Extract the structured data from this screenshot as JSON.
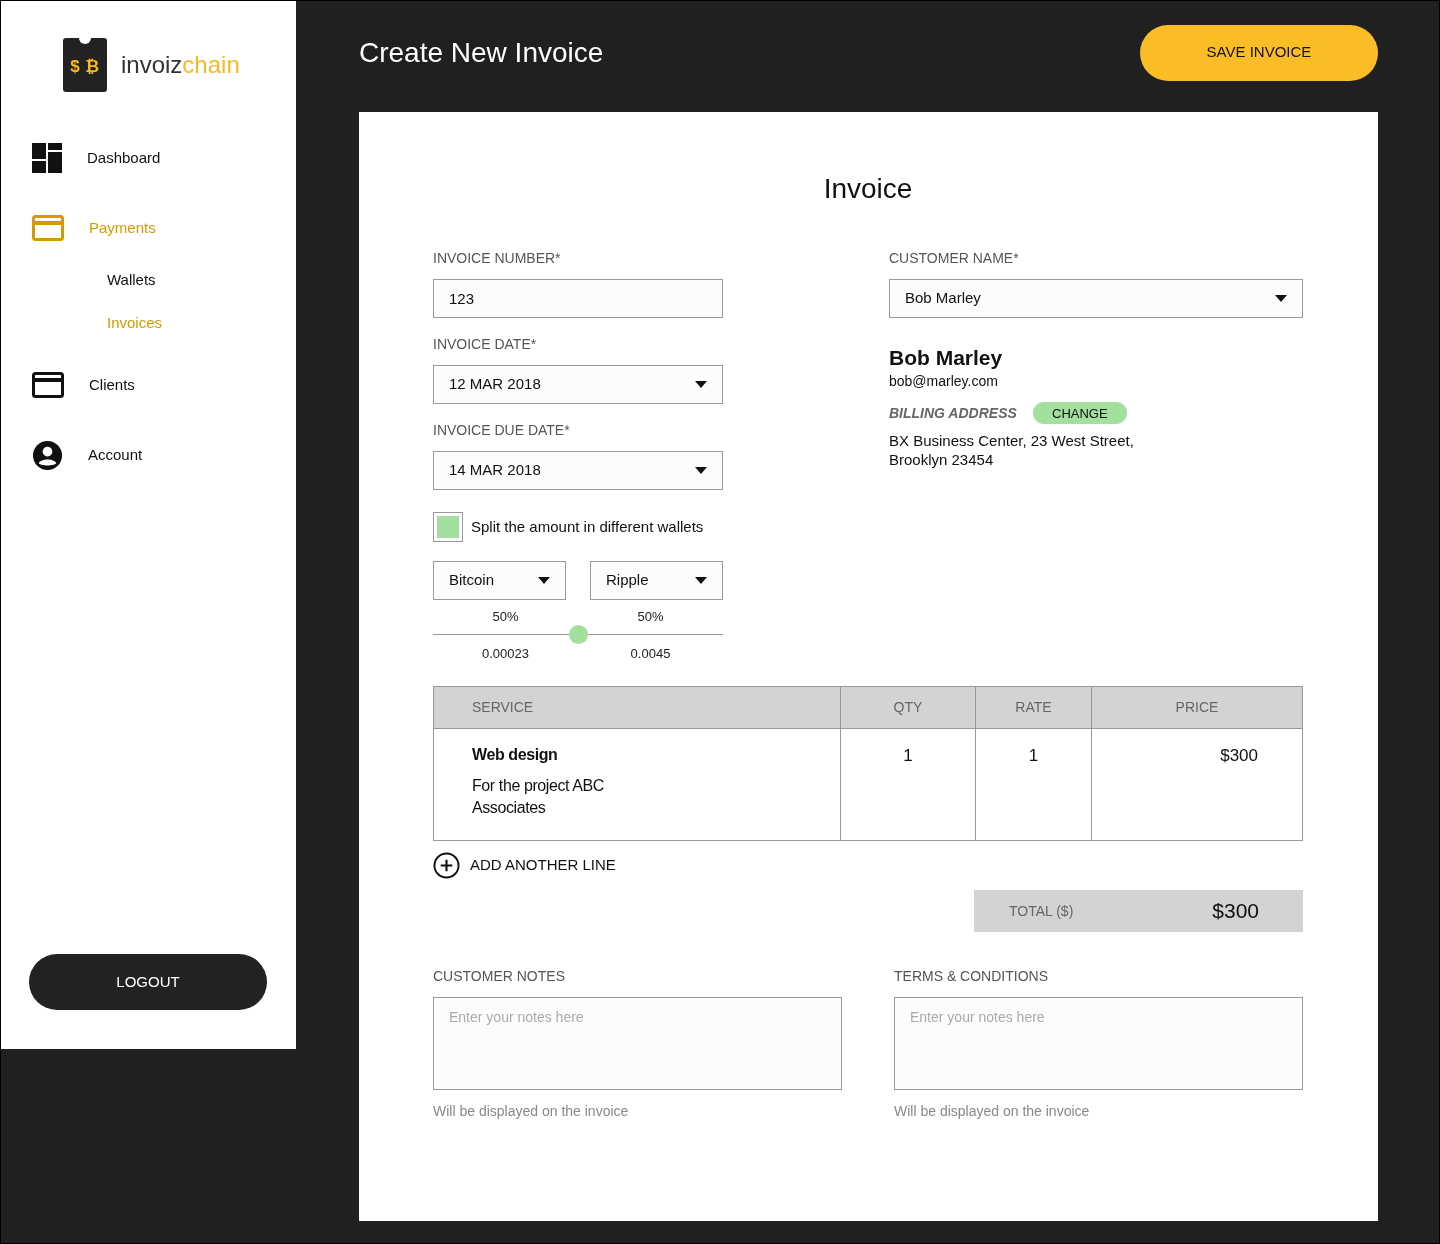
{
  "brand": {
    "logo_symbols": "$ ₿",
    "name_plain": "invoiz",
    "name_accent": "chain"
  },
  "sidebar": {
    "items": [
      {
        "kind": "dashboard",
        "label": "Dashboard",
        "selected": false
      },
      {
        "kind": "card",
        "label": "Payments",
        "selected": true,
        "children": [
          {
            "label": "Wallets",
            "selected": false
          },
          {
            "label": "Invoices",
            "selected": true
          }
        ]
      },
      {
        "kind": "card",
        "label": "Clients",
        "selected": false
      },
      {
        "kind": "account",
        "label": "Account",
        "selected": false
      }
    ],
    "logout": "LOGOUT"
  },
  "header": {
    "title": "Create New Invoice",
    "save_button": "SAVE INVOICE"
  },
  "invoice": {
    "title": "Invoice",
    "fields": [
      {
        "kind": "text",
        "label": "INVOICE NUMBER*",
        "value": "123"
      },
      {
        "kind": "dropdown",
        "label": "INVOICE DATE*",
        "value": "12 MAR 2018"
      },
      {
        "kind": "dropdown",
        "label": "INVOICE DUE DATE*",
        "value": "14 MAR 2018"
      }
    ],
    "split": {
      "label": "Split the amount in different wallets",
      "checked": true
    },
    "wallets": [
      {
        "currency": "Bitcoin",
        "percent": "50%",
        "amount": "0.00023"
      },
      {
        "currency": "Ripple",
        "percent": "50%",
        "amount": "0.0045"
      }
    ],
    "split_slider": {
      "level": 0.5
    },
    "customer": {
      "label": "CUSTOMER NAME*",
      "value": "Bob Marley",
      "name": "Bob Marley",
      "email": "bob@marley.com",
      "billing_label": "BILLING ADDRESS",
      "change_button": "CHANGE",
      "address": [
        "BX Business Center, 23 West Street,",
        "Brooklyn 23454"
      ]
    },
    "table": {
      "columns": [
        "SERVICE",
        "QTY",
        "RATE",
        "PRICE"
      ],
      "rows": [
        {
          "service": "Web design",
          "description": "For the project ABC Associates",
          "qty": "1",
          "rate": "1",
          "price": "$300"
        }
      ]
    },
    "add_line": "ADD ANOTHER LINE",
    "total": {
      "label": "TOTAL ($)",
      "value": "$300"
    },
    "notes": [
      {
        "label": "CUSTOMER NOTES",
        "placeholder": "Enter your notes here",
        "hint": "Will be displayed on the invoice"
      },
      {
        "label": "TERMS & CONDITIONS",
        "placeholder": "Enter your notes here",
        "hint": "Will be displayed on the invoice"
      }
    ]
  }
}
